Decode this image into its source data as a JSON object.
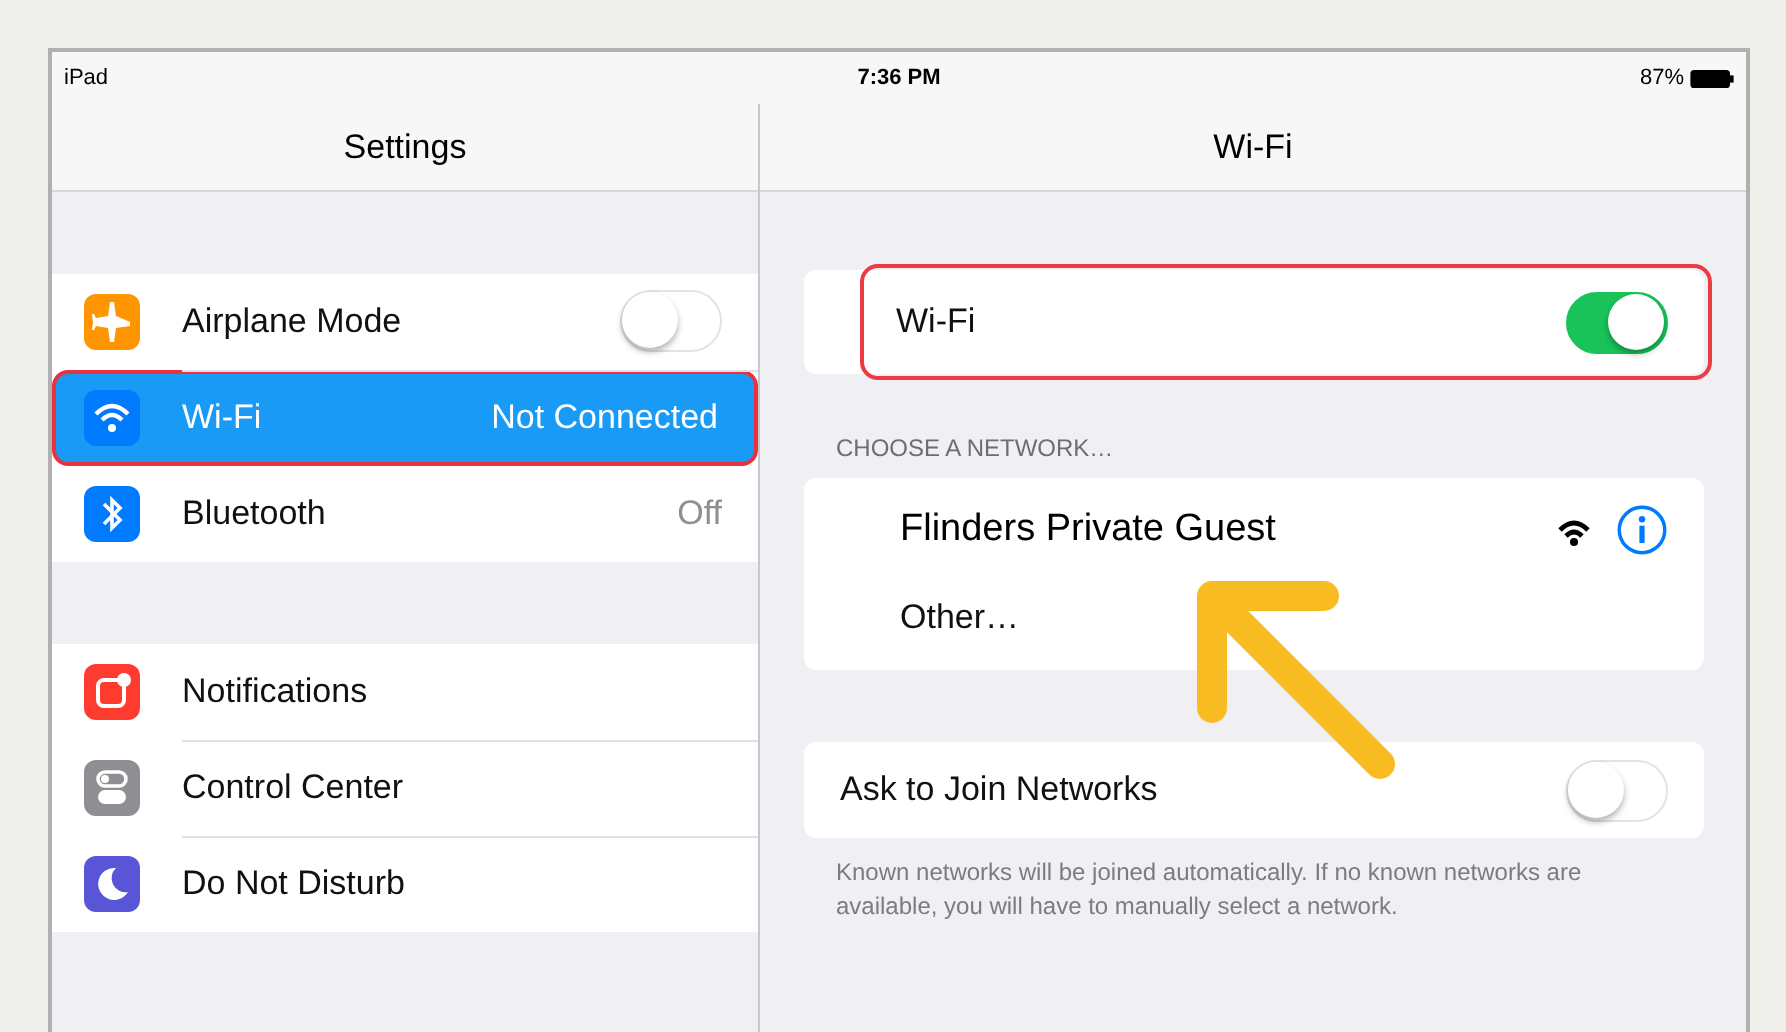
{
  "status_bar": {
    "device": "iPad",
    "time": "7:36 PM",
    "battery": "87%"
  },
  "sidebar": {
    "title": "Settings",
    "groups": [
      [
        {
          "label": "Airplane Mode",
          "kind": "toggle",
          "on": false,
          "selected": false,
          "annotated": false,
          "color": "#ff9500"
        },
        {
          "label": "Wi-Fi",
          "kind": "value",
          "value": "Not Connected",
          "selected": true,
          "annotated": true,
          "color": "#007aff"
        },
        {
          "label": "Bluetooth",
          "kind": "value",
          "value": "Off",
          "selected": false,
          "annotated": false,
          "color": "#007aff"
        }
      ],
      [
        {
          "label": "Notifications",
          "kind": "plain",
          "selected": false,
          "annotated": false,
          "color": "#ff3b30"
        },
        {
          "label": "Control Center",
          "kind": "plain",
          "selected": false,
          "annotated": false,
          "color": "#8e8e93"
        },
        {
          "label": "Do Not Disturb",
          "kind": "plain",
          "selected": false,
          "annotated": false,
          "color": "#5856d6"
        }
      ]
    ]
  },
  "detail": {
    "title": "Wi-Fi",
    "wifi_row": {
      "label": "Wi-Fi",
      "on": true,
      "annotated": true
    },
    "network_header": "CHOOSE A NETWORK…",
    "networks": [
      {
        "name": "Flinders Private Guest",
        "kind": "network"
      },
      {
        "name": "Other…",
        "kind": "other"
      }
    ],
    "ask_row": {
      "label": "Ask to Join Networks",
      "on": false
    },
    "footer": "Known networks will be joined automatically. If no known networks are available, you will have to manually select a network."
  }
}
